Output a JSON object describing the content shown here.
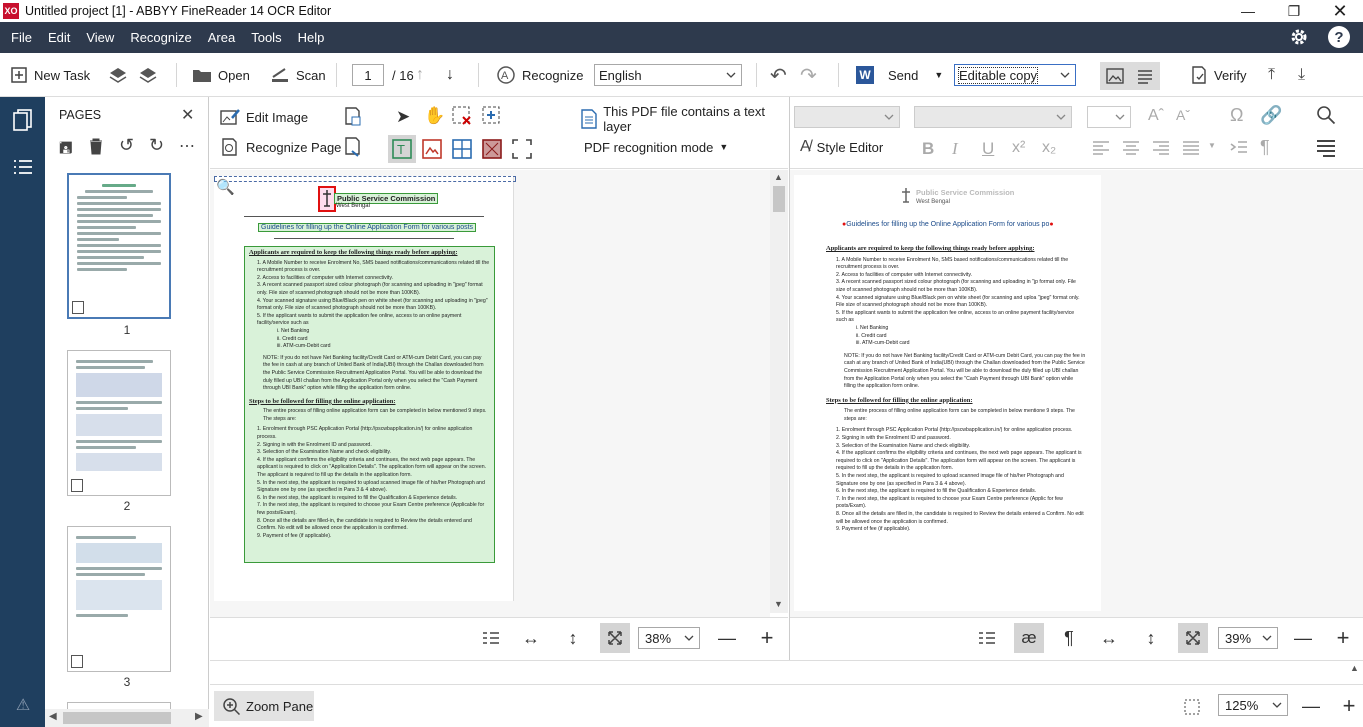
{
  "window": {
    "title": "Untitled project [1] - ABBYY FineReader 14 OCR Editor",
    "logo_text": "XO"
  },
  "menu": [
    "File",
    "Edit",
    "View",
    "Recognize",
    "Area",
    "Tools",
    "Help"
  ],
  "toolbar": {
    "new_task": "New Task",
    "open": "Open",
    "scan": "Scan",
    "page_current": "1",
    "page_total": "/ 16",
    "recognize": "Recognize",
    "language": "English",
    "send": "Send",
    "editable_copy": "Editable copy",
    "verify": "Verify"
  },
  "pages_panel": {
    "title": "PAGES",
    "thumbnails": [
      {
        "number": "1",
        "selected": true
      },
      {
        "number": "2",
        "selected": false
      },
      {
        "number": "3",
        "selected": false
      }
    ]
  },
  "image_pane": {
    "edit_image": "Edit Image",
    "recognize_page": "Recognize Page",
    "pdf_text_layer": "This PDF file contains a text layer",
    "pdf_mode": "PDF recognition mode",
    "zoom": "38%",
    "doc": {
      "org": "Public Service Commission",
      "state": "West Bengal",
      "heading": "Guidelines for filling up the Online Application Form for various posts",
      "section1": "Applicants are required to keep the following things ready before applying:",
      "items1": [
        "1.   A Mobile Number to receive Enrolment No, SMS based notifications/communications related till the recruitment process is over.",
        "2.   Access to facilities of computer with Internet connectivity.",
        "3.   A recent scanned passport sized colour photograph (for scanning and uploading in \"jpeg\" format only. File size of scanned photograph should not be more than 100KB).",
        "4.   Your scanned signature using Blue/Black pen on white sheet (for scanning and uploading in \"jpeg\" format only. File size of scanned photograph should not be more than 100KB).",
        "5.   If the applicant wants to submit the application fee online, access to an online payment facility/service such as",
        "      i.   Net Banking",
        "      ii.  Credit card",
        "      iii. ATM-cum-Debit card"
      ],
      "note": "NOTE: If you do not have Net Banking facility/Credit Card or ATM-cum Debit Card, you can pay the fee in cash at any branch of United Bank of India(UBI) through the Challan downloaded from the Public Service Commission Recruitment Application Portal. You will be able to download the duly filled up UBI challan from the Application Portal only when you select the \"Cash Payment through UBI Bank\" option while filling the application form online.",
      "section2": "Steps to be followed for filling the online application:",
      "intro2": "The entire process of filling online application form can be completed in below mentioned 9 steps. The steps are:",
      "items2": [
        "1.   Enrolment through PSC Application Portal (http://pscwbapplication.in/) for online application process.",
        "2.   Signing in with the Enrolment ID and password.",
        "3.   Selection of the Examination Name and check eligibility.",
        "4.   If the applicant confirms the eligibility criteria and continues, the next web page appears. The applicant is required to click on \"Application Details\". The application form will appear on the screen. The applicant is required to fill up the details in the application form.",
        "5.   In the next step, the applicant is required to upload scanned image file of his/her Photograph and Signature one by one (as specified in Para 3 & 4 above).",
        "6.   In the next step, the applicant is required to fill the Qualification & Experience details.",
        "7.   In the next step, the applicant is required to choose your Exam Centre preference (Applicable for few posts/Exam).",
        "8.   Once all the details are filled-in, the candidate is required to Review the details entered and Confirm. No edit will be allowed once the application is confirmed.",
        "9.   Payment of fee (if applicable)."
      ]
    }
  },
  "text_pane": {
    "style_editor": "Style Editor",
    "zoom": "39%",
    "doc": {
      "org": "Public Service Commission",
      "state": "West Bengal",
      "heading": "Guidelines for filling up the Online Application Form for various po",
      "section1": "Applicants are required to keep the following things ready before applying:",
      "items1": [
        "1.        A Mobile Number to receive Enrolment No, SMS based notifications/communications related till the recruitment process is over.",
        "2.        Access to facilities of computer with Internet connectivity.",
        "3.        A recent scanned passport sized colour photograph (for scanning and uploading in \"jp format only. File size of scanned photograph should not be more than 100KB).",
        "4.        Your scanned signature using Blue/Black pen on white sheet (for scanning and uploa \"jpeg\" format only. File size of scanned photograph should not be more than 100KB).",
        "5.        If the applicant wants to submit the application fee online, access to an online payment facility/service such as",
        "          i.    Net Banking",
        "          ii.   Credit card",
        "          iii.  ATM-cum-Debit card"
      ],
      "note": "NOTE: If you do not have Net Banking facility/Credit Card or ATM-cum Debit Card, you can pay the fee in cash at any branch of United Bank of India(UBI) through the Challan downloaded from the Public Service Commission Recruitment Application Portal. You will be able to download the duly filled up UBI challan from the Application Portal only when you select the \"Cash Payment through UBI Bank\" option while filling the application form online.",
      "section2": "Steps to be followed for filling the online application:",
      "intro2": "The entire process of filling online application form can be completed in below mentione 9 steps. The steps are:",
      "items2": [
        "1.   Enrolment through PSC Application Portal (http://pscwbapplication.in/) for online application process.",
        "2.   Signing in with the Enrolment ID and password.",
        "3.   Selection of the Examination Name and check eligibility.",
        "4.   If the applicant confirms the eligibility criteria and continues, the next web page appears. The applicant is required to click on \"Application Details\". The application form will appear on the screen. The applicant is required to fill up the details in the application form.",
        "5.   In the next step, the applicant is required to upload scanned image file of his/her Photograph and Signature one by one (as specified in Para 3 & 4 above).",
        "6.   In the next step, the applicant is required to fill the Qualification & Experience details.",
        "7.   In the next step, the applicant is required to choose your Exam Centre preference (Applic for few posts/Exam).",
        "8.   Once all the details are filled in, the candidate is required to Review the details entered a Confirm. No edit will be allowed once the application is confirmed.",
        "9.   Payment of fee (if applicable)."
      ]
    }
  },
  "status": {
    "zoom_pane": "Zoom Pane",
    "zoom": "125%"
  },
  "colors": {
    "menubar": "#2e3a4d",
    "sidebar": "#1f3f5f",
    "highlight_green": "#d9f2d9",
    "selection": "#4a7ab5"
  }
}
